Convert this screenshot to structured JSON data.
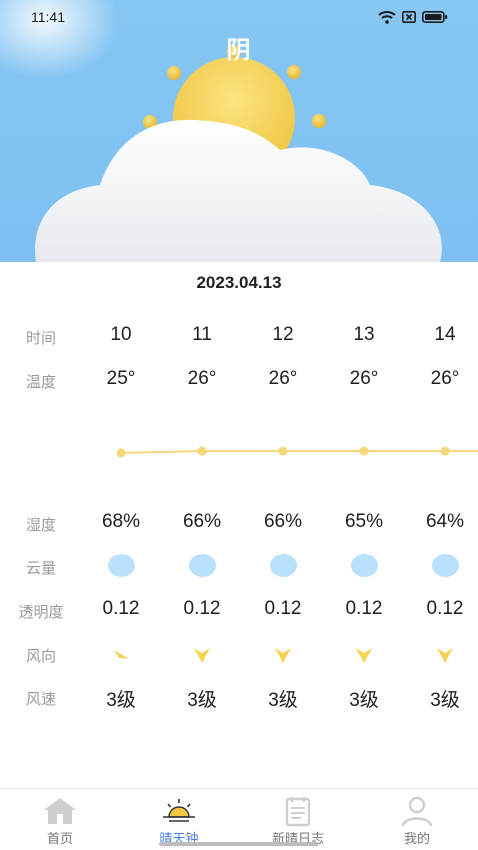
{
  "status": {
    "time": "11:41"
  },
  "weather": {
    "condition": "阴"
  },
  "date": "2023.04.13",
  "labels": {
    "time": "时间",
    "temperature": "温度",
    "humidity": "湿度",
    "cloud": "云量",
    "transparency": "透明度",
    "wind_dir": "风向",
    "wind_speed": "风速"
  },
  "hours": [
    "10",
    "11",
    "12",
    "13",
    "14"
  ],
  "temperatures": [
    "25°",
    "26°",
    "26°",
    "26°",
    "26°"
  ],
  "humidity": [
    "68%",
    "66%",
    "66%",
    "65%",
    "64%"
  ],
  "cloud_icons": [
    "cloud-amount-icon",
    "cloud-amount-icon",
    "cloud-amount-icon",
    "cloud-amount-icon",
    "cloud-amount-icon"
  ],
  "transparency": [
    "0.12",
    "0.12",
    "0.12",
    "0.12",
    "0.12"
  ],
  "wind_direction_icons": [
    "wind-arrow-southwest-icon",
    "wind-arrow-south-icon",
    "wind-arrow-south-icon",
    "wind-arrow-south-icon",
    "wind-arrow-south-icon"
  ],
  "wind_speed": [
    "3级",
    "3级",
    "3级",
    "3级",
    "3级"
  ],
  "chart_data": {
    "type": "line",
    "x": [
      "10",
      "11",
      "12",
      "13",
      "14"
    ],
    "values": [
      25,
      26,
      26,
      26,
      26
    ],
    "color": "#f5d67a"
  },
  "nav": [
    {
      "label": "首页",
      "icon": "home-icon",
      "active": false
    },
    {
      "label": "晴天钟",
      "icon": "sunrise-icon",
      "active": true
    },
    {
      "label": "新晴日志",
      "icon": "journal-icon",
      "active": false
    },
    {
      "label": "我的",
      "icon": "person-icon",
      "active": false
    }
  ],
  "colors": {
    "sky": "#86c6f3",
    "accent": "#4a82e6",
    "sun": "#f6d25a",
    "cloud_dot": "#b9e1fb",
    "wind_arrow": "#f7d355"
  }
}
